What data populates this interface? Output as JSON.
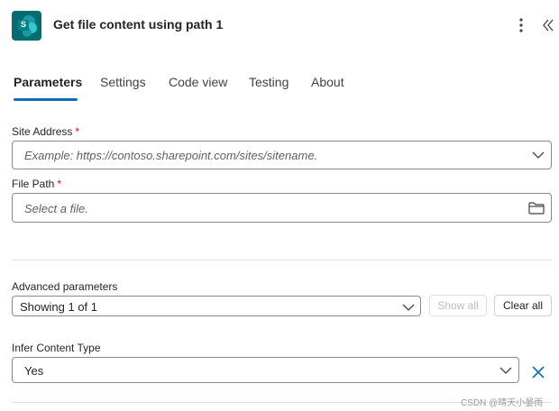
{
  "header": {
    "title": "Get file content using path 1",
    "app_icon": "sharepoint-icon",
    "app_icon_letter": "S",
    "more_icon": "more-vertical-icon",
    "collapse_icon": "collapse-double-chevron-icon"
  },
  "tabs": [
    {
      "label": "Parameters",
      "active": true
    },
    {
      "label": "Settings",
      "active": false
    },
    {
      "label": "Code view",
      "active": false
    },
    {
      "label": "Testing",
      "active": false
    },
    {
      "label": "About",
      "active": false
    }
  ],
  "site_address": {
    "label": "Site Address",
    "required_mark": "*",
    "placeholder": "Example: https://contoso.sharepoint.com/sites/sitename."
  },
  "file_path": {
    "label": "File Path",
    "required_mark": "*",
    "placeholder": "Select a file.",
    "icon": "folder-icon"
  },
  "advanced": {
    "label": "Advanced parameters",
    "dropdown_value": "Showing 1 of 1",
    "show_all_label": "Show all",
    "clear_all_label": "Clear all"
  },
  "infer_content_type": {
    "label": "Infer Content Type",
    "value": "Yes",
    "remove_icon": "close-icon"
  },
  "watermark": "CSDN @晴天小晏雨",
  "colors": {
    "accent": "#0f6cbd",
    "sharepoint_teal": "#036c70",
    "required": "#c50f1f"
  }
}
